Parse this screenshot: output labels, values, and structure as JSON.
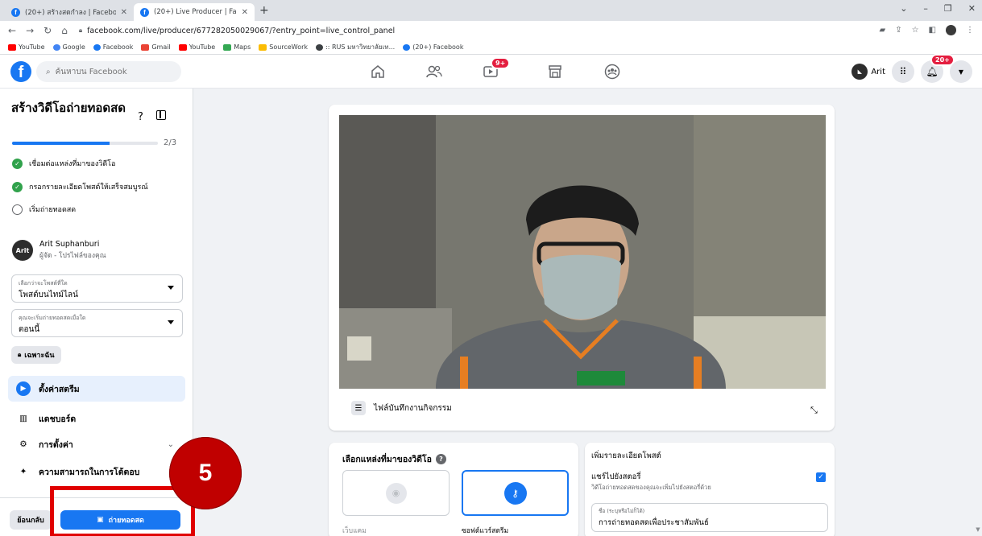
{
  "browser": {
    "tabs": [
      {
        "title": "(20+) สร้างสดกำลง | Facebook"
      },
      {
        "title": "(20+) Live Producer | Facebook"
      }
    ],
    "url": "facebook.com/live/producer/677282050029067/?entry_point=live_control_panel",
    "bookmarks": [
      {
        "label": "YouTube",
        "color": "#ff0000"
      },
      {
        "label": "Google",
        "color": "#4285f4"
      },
      {
        "label": "Facebook",
        "color": "#1877f2"
      },
      {
        "label": "Gmail",
        "color": "#ea4335"
      },
      {
        "label": "YouTube",
        "color": "#ff0000"
      },
      {
        "label": "Maps",
        "color": "#34a853"
      },
      {
        "label": "SourceWork",
        "color": "#fbbc04"
      },
      {
        "label": ":: RUS มหาวิทยาลัยเท...",
        "color": "#3c4043"
      },
      {
        "label": "(20+) Facebook",
        "color": "#1877f2"
      }
    ]
  },
  "fb": {
    "search_placeholder": "ค้นหาบน Facebook",
    "video_badge": "9+",
    "user_name": "Arit",
    "notif_badge": "20+"
  },
  "sidebar": {
    "title": "สร้างวิดีโอถ่ายทอดสด",
    "progress_text": "2/3",
    "progress_fraction": 0.667,
    "steps": [
      {
        "label": "เชื่อมต่อแหล่งที่มาของวิดีโอ",
        "done": true
      },
      {
        "label": "กรอกรายละเอียดโพสต์ให้เสร็จสมบูรณ์",
        "done": true
      },
      {
        "label": "เริ่มถ่ายทอดสด",
        "done": false
      }
    ],
    "owner_name": "Arit Suphanburi",
    "owner_role": "ผู้จัด - โปรไฟล์ของคุณ",
    "avatar_text": "Arit",
    "select_post": {
      "label": "เลือกว่าจะโพสต์ที่ใด",
      "value": "โพสต์บนไทม์ไลน์"
    },
    "select_time": {
      "label": "คุณจะเริ่มถ่ายทอดสดเมื่อใด",
      "value": "ตอนนี้"
    },
    "privacy_label": "เฉพาะฉัน",
    "menu": [
      {
        "label": "ตั้งค่าสตรีม"
      },
      {
        "label": "แดชบอร์ด"
      },
      {
        "label": "การตั้งค่า"
      },
      {
        "label": "ความสามารถในการโต้ตอบ"
      }
    ],
    "back_label": "ย้อนกลับ",
    "golive_label": "ถ่ายทอดสด"
  },
  "annotation": {
    "step_number": "5"
  },
  "main": {
    "video_footer_label": "ไฟล์บันทึกงานกิจกรรม",
    "source_title": "เลือกแหล่งที่มาของวิดีโอ",
    "source_opt1": "เว็บแคม",
    "source_opt2": "ซอฟต์แวร์สตรีม",
    "post_title": "เพิ่มรายละเอียดโพสต์",
    "share_story": "แชร์ไปยังสตอรี่",
    "share_story_sub": "วิดีโอถ่ายทอดสดของคุณจะเพิ่มไปยังสตอรี่ด้วย",
    "title_field_label": "ชื่อ (ระบุหรือไม่ก็ได้)",
    "title_field_value": "การถ่ายทอดสดเพื่อประชาสัมพันธ์"
  }
}
